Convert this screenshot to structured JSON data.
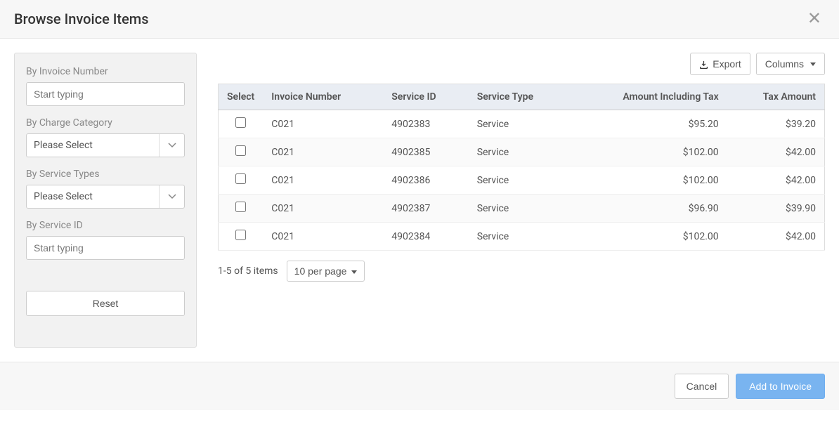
{
  "header": {
    "title": "Browse Invoice Items"
  },
  "filters": {
    "invoice_number": {
      "label": "By Invoice Number",
      "placeholder": "Start typing",
      "value": ""
    },
    "charge_category": {
      "label": "By Charge Category",
      "selected": "Please Select"
    },
    "service_types": {
      "label": "By Service Types",
      "selected": "Please Select"
    },
    "service_id": {
      "label": "By Service ID",
      "placeholder": "Start typing",
      "value": ""
    },
    "reset_label": "Reset"
  },
  "toolbar": {
    "export_label": "Export",
    "columns_label": "Columns"
  },
  "table": {
    "headers": {
      "select": "Select",
      "invoice_number": "Invoice Number",
      "service_id": "Service ID",
      "service_type": "Service Type",
      "amount_incl_tax": "Amount Including Tax",
      "tax_amount": "Tax Amount"
    },
    "rows": [
      {
        "invoice_number": "C021",
        "service_id": "4902383",
        "service_type": "Service",
        "amount_incl_tax": "$95.20",
        "tax_amount": "$39.20"
      },
      {
        "invoice_number": "C021",
        "service_id": "4902385",
        "service_type": "Service",
        "amount_incl_tax": "$102.00",
        "tax_amount": "$42.00"
      },
      {
        "invoice_number": "C021",
        "service_id": "4902386",
        "service_type": "Service",
        "amount_incl_tax": "$102.00",
        "tax_amount": "$42.00"
      },
      {
        "invoice_number": "C021",
        "service_id": "4902387",
        "service_type": "Service",
        "amount_incl_tax": "$96.90",
        "tax_amount": "$39.90"
      },
      {
        "invoice_number": "C021",
        "service_id": "4902384",
        "service_type": "Service",
        "amount_incl_tax": "$102.00",
        "tax_amount": "$42.00"
      }
    ]
  },
  "pagination": {
    "summary": "1-5 of 5 items",
    "per_page_label": "10 per page"
  },
  "footer": {
    "cancel_label": "Cancel",
    "add_label": "Add to Invoice"
  }
}
